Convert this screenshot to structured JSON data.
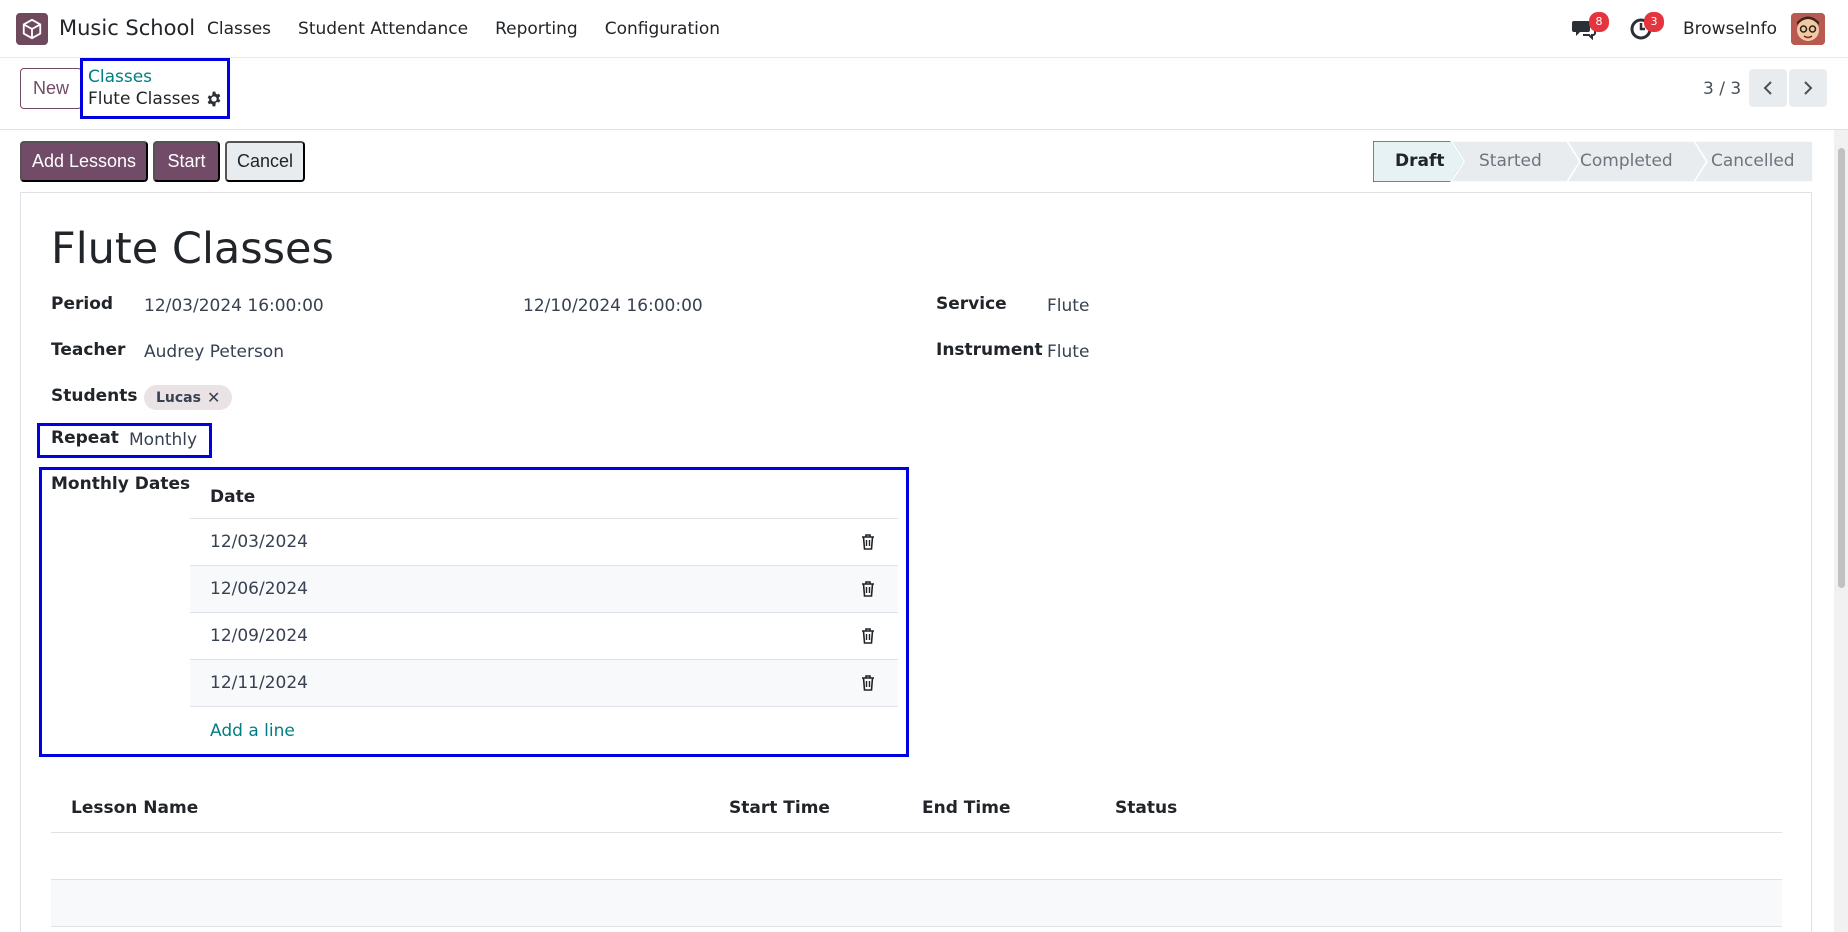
{
  "navbar": {
    "app_name": "Music School",
    "menu": [
      "Classes",
      "Student Attendance",
      "Reporting",
      "Configuration"
    ],
    "messages_count": "8",
    "activities_count": "3",
    "user_name": "BrowseInfo"
  },
  "control_panel": {
    "new_label": "New",
    "breadcrumb_parent": "Classes",
    "breadcrumb_current": "Flute Classes",
    "pager": "3 / 3"
  },
  "actions": {
    "add_lessons": "Add Lessons",
    "start": "Start",
    "cancel": "Cancel"
  },
  "status": {
    "stages": [
      "Draft",
      "Started",
      "Completed",
      "Cancelled"
    ],
    "active": "Draft"
  },
  "form": {
    "title": "Flute Classes",
    "period_label": "Period",
    "period_start": "12/03/2024 16:00:00",
    "period_end": "12/10/2024 16:00:00",
    "teacher_label": "Teacher",
    "teacher": "Audrey Peterson",
    "students_label": "Students",
    "students": [
      "Lucas"
    ],
    "service_label": "Service",
    "service": "Flute",
    "instrument_label": "Instrument",
    "instrument": "Flute",
    "repeat_label": "Repeat",
    "repeat": "Monthly",
    "monthly_dates_label": "Monthly Dates",
    "monthly_dates_header": "Date",
    "monthly_dates": [
      "12/03/2024",
      "12/06/2024",
      "12/09/2024",
      "12/11/2024"
    ],
    "add_line": "Add a line"
  },
  "lessons": {
    "columns": [
      "Lesson Name",
      "Start Time",
      "End Time",
      "Status"
    ]
  },
  "colors": {
    "brand": "#714b67",
    "link": "#017e84",
    "highlight": "#0000e0",
    "badge": "#e4353f"
  }
}
